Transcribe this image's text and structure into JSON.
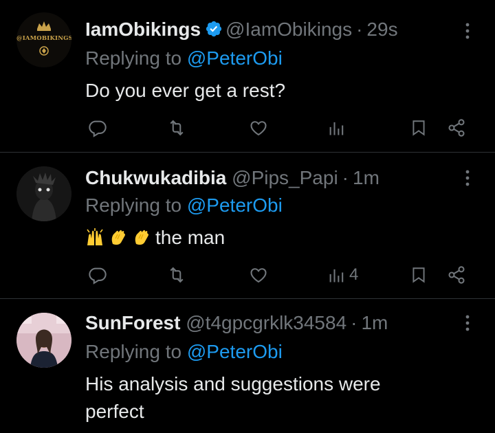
{
  "tweets": [
    {
      "name": "IamObikings",
      "verified": true,
      "handle": "@IamObikings",
      "separator": "·",
      "time": "29s",
      "reply_prefix": "Replying to",
      "reply_handle": "@PeterObi",
      "text": "Do you ever get a rest?",
      "views": "",
      "avatar_text": "@IAMOBIKINGS"
    },
    {
      "name": "Chukwukadibia",
      "verified": false,
      "handle": "@Pips_Papi",
      "separator": "·",
      "time": "1m",
      "reply_prefix": "Replying to",
      "reply_handle": "@PeterObi",
      "emojis": [
        "raising-hands",
        "clapping-hands",
        "clapping-hands"
      ],
      "text": "the man",
      "views": "4"
    },
    {
      "name": "SunForest",
      "verified": false,
      "handle": "@t4gpcgrklk34584",
      "separator": "·",
      "time": "1m",
      "reply_prefix": "Replying to",
      "reply_handle": "@PeterObi",
      "text": "His analysis and suggestions were perfect"
    }
  ],
  "icons": {
    "reply": "reply-icon",
    "retweet": "retweet-icon",
    "like": "heart-icon",
    "views": "views-icon",
    "bookmark": "bookmark-icon",
    "share": "share-icon",
    "more": "more-options-icon",
    "verified": "verified-badge-icon"
  },
  "colors": {
    "background": "#000000",
    "text": "#e7e9ea",
    "muted": "#71767b",
    "link": "#1d9bf0",
    "divider": "#2f3336"
  }
}
